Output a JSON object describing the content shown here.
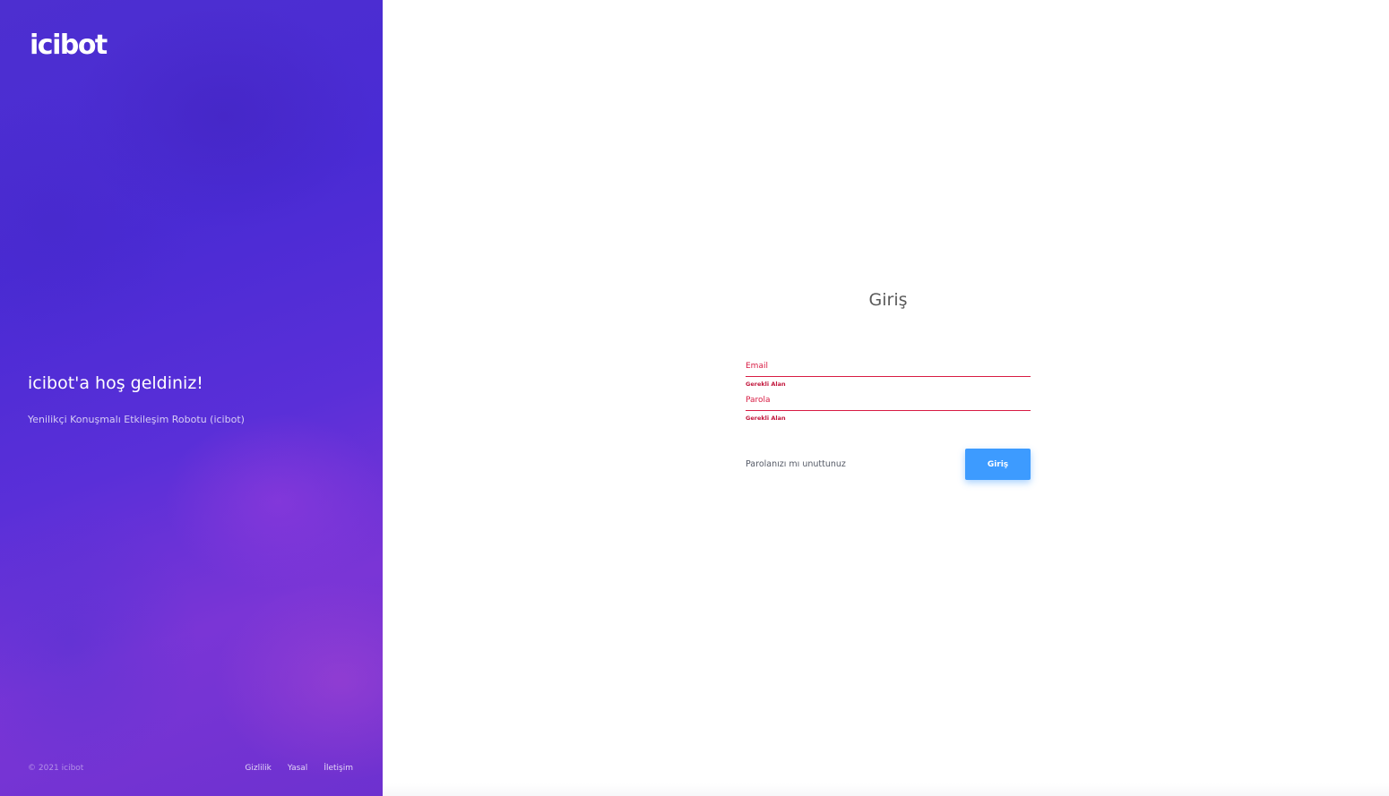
{
  "brand": {
    "logo_text": "icibot",
    "primary_color": "#3d9bff",
    "error_color": "#d81b43",
    "panel_gradient": [
      "#4a2bd4",
      "#7a35d6"
    ]
  },
  "welcome": {
    "title": "icibot'a hoş geldiniz!",
    "subtitle": "Yenilikçi Konuşmalı Etkileşim Robotu (icibot)"
  },
  "footer": {
    "copyright": "© 2021 icibot",
    "links": [
      "Gizlilik",
      "Yasal",
      "İletişim"
    ]
  },
  "login": {
    "title": "Giriş",
    "email": {
      "label": "Email",
      "value": "",
      "error": "Gerekli Alan"
    },
    "password": {
      "label": "Parola",
      "value": "",
      "error": "Gerekli Alan"
    },
    "forgot_password": "Parolanızı mı unuttunuz",
    "submit_label": "Giriş"
  }
}
